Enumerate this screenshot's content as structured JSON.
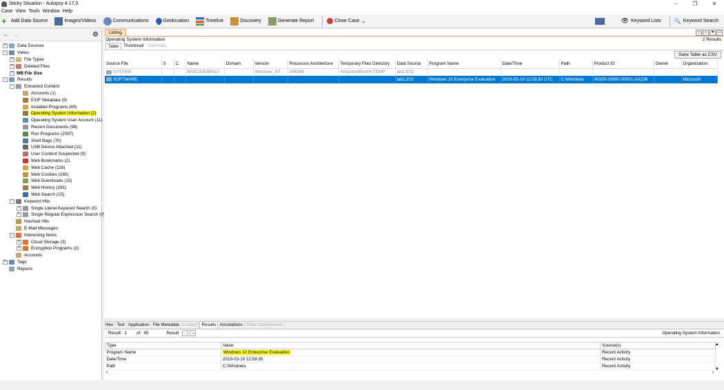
{
  "window": {
    "title": "Sticky Situation - Autopsy 4.17.0",
    "minimize": "–",
    "maximize": "❐",
    "close": "✕"
  },
  "menu": [
    "Case",
    "View",
    "Tools",
    "Window",
    "Help"
  ],
  "toolbar": {
    "add_data_source": "Add Data Source",
    "images_videos": "Images/Videos",
    "communications": "Communications",
    "geolocation": "Geolocation",
    "timeline": "Timeline",
    "discovery": "Discovery",
    "generate_report": "Generate Report",
    "close_case": "Close Case",
    "keyword_lists": "Keyword Lists",
    "keyword_search": "Keyword Search"
  },
  "tree": [
    {
      "label": "Data Sources",
      "level": 0,
      "exp": "+",
      "icon": "#8aa4c8"
    },
    {
      "label": "Views",
      "level": 0,
      "exp": "−",
      "icon": "#6a8ab0"
    },
    {
      "label": "File Types",
      "level": 1,
      "exp": "+",
      "icon": "#d9b36a"
    },
    {
      "label": "Deleted Files",
      "level": 1,
      "exp": "+",
      "icon": "#c77"
    },
    {
      "label": "MB File Size",
      "level": 1,
      "exp": "+",
      "icon": ""
    },
    {
      "label": "Results",
      "level": 0,
      "exp": "−",
      "icon": "#7a9abc"
    },
    {
      "label": "Extracted Content",
      "level": 1,
      "exp": "−",
      "icon": "#9b9b9b"
    },
    {
      "label": "Accounts (1)",
      "level": 2,
      "exp": "",
      "icon": "#c9a56a"
    },
    {
      "label": "EXIF Metadata (9)",
      "level": 2,
      "exp": "",
      "icon": "#b87333"
    },
    {
      "label": "Installed Programs (40)",
      "level": 2,
      "exp": "",
      "icon": "#e0a43a"
    },
    {
      "label": "Operating System Information (2)",
      "level": 2,
      "exp": "",
      "icon": "#8b7b3a",
      "highlight": true
    },
    {
      "label": "Operating System User Account (11)",
      "level": 2,
      "exp": "",
      "icon": "#5b8fc7"
    },
    {
      "label": "Recent Documents (98)",
      "level": 2,
      "exp": "",
      "icon": "#999"
    },
    {
      "label": "Run Programs (2097)",
      "level": 2,
      "exp": "",
      "icon": "#5a8a4a"
    },
    {
      "label": "Shell Bags (70)",
      "level": 2,
      "exp": "",
      "icon": "#4a7ab0"
    },
    {
      "label": "USB Device Attached (11)",
      "level": 2,
      "exp": "",
      "icon": "#666"
    },
    {
      "label": "User Content Suspected (9)",
      "level": 2,
      "exp": "",
      "icon": "#c66"
    },
    {
      "label": "Web Bookmarks (2)",
      "level": 2,
      "exp": "",
      "icon": "#c33"
    },
    {
      "label": "Web Cache (116)",
      "level": 2,
      "exp": "",
      "icon": "#d9a33a"
    },
    {
      "label": "Web Cookies (180)",
      "level": 2,
      "exp": "",
      "icon": "#c9923a"
    },
    {
      "label": "Web Downloads (15)",
      "level": 2,
      "exp": "",
      "icon": "#8a9a5a"
    },
    {
      "label": "Web History (281)",
      "level": 2,
      "exp": "",
      "icon": "#a07a4a"
    },
    {
      "label": "Web Search (15)",
      "level": 2,
      "exp": "",
      "icon": "#3a6ab0"
    },
    {
      "label": "Keyword Hits",
      "level": 1,
      "exp": "−",
      "icon": "#777"
    },
    {
      "label": "Single Literal Keyword Search (0)",
      "level": 2,
      "exp": "+",
      "icon": "#999"
    },
    {
      "label": "Single Regular Expression Search (0)",
      "level": 2,
      "exp": "+",
      "icon": "#999"
    },
    {
      "label": "Hashset Hits",
      "level": 1,
      "exp": "",
      "icon": "#c9923a"
    },
    {
      "label": "E-Mail Messages",
      "level": 1,
      "exp": "",
      "icon": "#c9a56a"
    },
    {
      "label": "Interesting Items",
      "level": 1,
      "exp": "−",
      "icon": "#e8702a"
    },
    {
      "label": "Cloud Storage (3)",
      "level": 2,
      "exp": "+",
      "icon": "#e8702a"
    },
    {
      "label": "Encryption Programs (2)",
      "level": 2,
      "exp": "+",
      "icon": "#e8702a"
    },
    {
      "label": "Accounts",
      "level": 1,
      "exp": "",
      "icon": "#c9a56a"
    },
    {
      "label": "Tags",
      "level": 0,
      "exp": "+",
      "icon": "#5a8ac7"
    },
    {
      "label": "Reports",
      "level": 0,
      "exp": "",
      "icon": "#8aa"
    }
  ],
  "listing": {
    "tab": "Listing",
    "title": "Operating System Information",
    "count": "2 Results",
    "subtabs": [
      {
        "label": "Table",
        "state": "active"
      },
      {
        "label": "Thumbnail",
        "state": "normal"
      },
      {
        "label": "Summary",
        "state": "disabled"
      }
    ],
    "save_csv": "Save Table as CSV",
    "columns": [
      "Source File",
      "S",
      "C",
      "Name",
      "Domain",
      "Version",
      "Processor Architecture",
      "Temporary Files Directory",
      "Data Source",
      "Program Name",
      "Date/Time",
      "Path",
      "Product ID",
      "Owner",
      "Organization"
    ],
    "rows": [
      {
        "selected": false,
        "cells": [
          "SYSTEM",
          "",
          "",
          "MSEDGEWIN10",
          "",
          "Windows_NT",
          "AMD64",
          "%SystemRoot%\\TEMP",
          "lab1.E01",
          "",
          "",
          "",
          "",
          "",
          ""
        ]
      },
      {
        "selected": true,
        "cells": [
          "SOFTWARE",
          "",
          "",
          "",
          "",
          "",
          "",
          "",
          "lab1.E01",
          "Windows 10 Enterprise Evaluation",
          "2019-03-19 12:59:35 UTC",
          "C:\\Windows",
          "00329-20000-00001-AA236",
          "",
          "Microsoft"
        ]
      }
    ]
  },
  "viewer": {
    "tabs": [
      {
        "label": "Hex",
        "state": "normal"
      },
      {
        "label": "Text",
        "state": "normal"
      },
      {
        "label": "Application",
        "state": "normal"
      },
      {
        "label": "File Metadata",
        "state": "normal"
      },
      {
        "label": "Context",
        "state": "disabled"
      },
      {
        "label": "Results",
        "state": "active"
      },
      {
        "label": "Annotations",
        "state": "normal"
      },
      {
        "label": "Other Occurrences",
        "state": "disabled"
      }
    ],
    "result_label": "Result:",
    "result_index": "1",
    "result_of": "of",
    "result_total": "45",
    "result_nav_label": "Result",
    "artifact_type": "Operating System Information",
    "columns": [
      "Type",
      "Value",
      "Source(s)"
    ],
    "rows": [
      {
        "type": "Program Name",
        "value": "Windows 10 Enterprise Evaluation",
        "source": "Recent Activity",
        "highlight": true
      },
      {
        "type": "Date/Time",
        "value": "2019-03-19 12:59:35",
        "source": "Recent Activity"
      },
      {
        "type": "Path",
        "value": "C:\\Windows",
        "source": "Recent Activity"
      }
    ]
  }
}
